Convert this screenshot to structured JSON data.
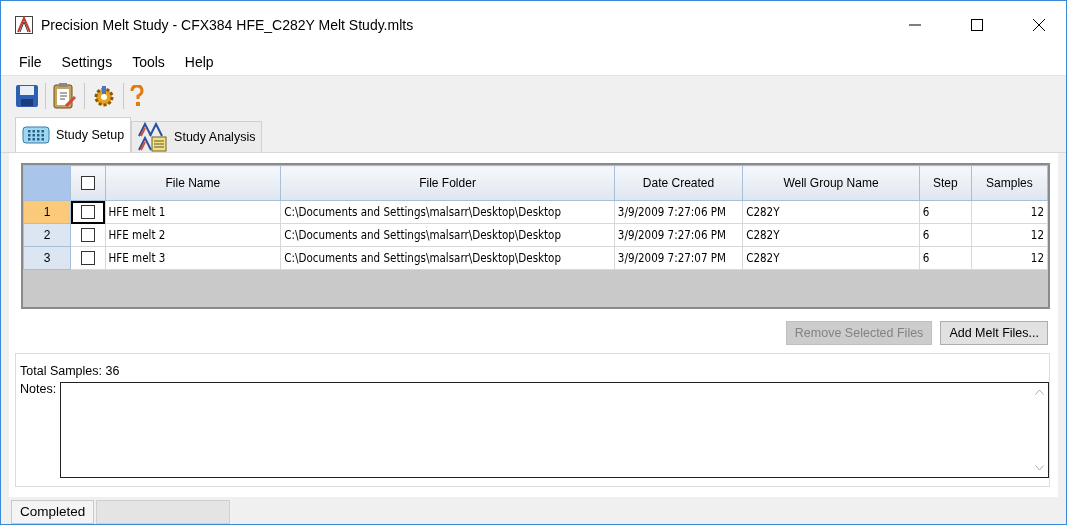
{
  "window": {
    "title": "Precision Melt Study - CFX384 HFE_C282Y Melt Study.mlts"
  },
  "menu": [
    "File",
    "Settings",
    "Tools",
    "Help"
  ],
  "tabs": [
    {
      "label": "Study Setup",
      "selected": true,
      "kind": "plate"
    },
    {
      "label": "Study Analysis",
      "selected": false,
      "kind": "analysis"
    }
  ],
  "table": {
    "header_checked": false,
    "columns": [
      "File Name",
      "File Folder",
      "Date Created",
      "Well Group Name",
      "Step",
      "Samples"
    ],
    "rows": [
      {
        "number": "1",
        "selected": true,
        "checked": false,
        "cells": [
          "HFE melt 1",
          "C:\\Documents and Settings\\malsarr\\Desktop\\Desktop",
          "3/9/2009 7:27:06 PM",
          "C282Y",
          "6",
          "12"
        ]
      },
      {
        "number": "2",
        "selected": false,
        "checked": false,
        "cells": [
          "HFE melt 2",
          "C:\\Documents and Settings\\malsarr\\Desktop\\Desktop",
          "3/9/2009 7:27:06 PM",
          "C282Y",
          "6",
          "12"
        ]
      },
      {
        "number": "3",
        "selected": false,
        "checked": false,
        "cells": [
          "HFE melt 3",
          "C:\\Documents and Settings\\malsarr\\Desktop\\Desktop",
          "3/9/2009 7:27:07 PM",
          "C282Y",
          "6",
          "12"
        ]
      }
    ]
  },
  "buttons": [
    {
      "label": "Remove Selected Files",
      "disabled": true
    },
    {
      "label": "Add Melt Files...",
      "disabled": false
    }
  ],
  "total_samples": "Total Samples: 36",
  "notes_label": "Notes:",
  "status_bar": "Completed"
}
